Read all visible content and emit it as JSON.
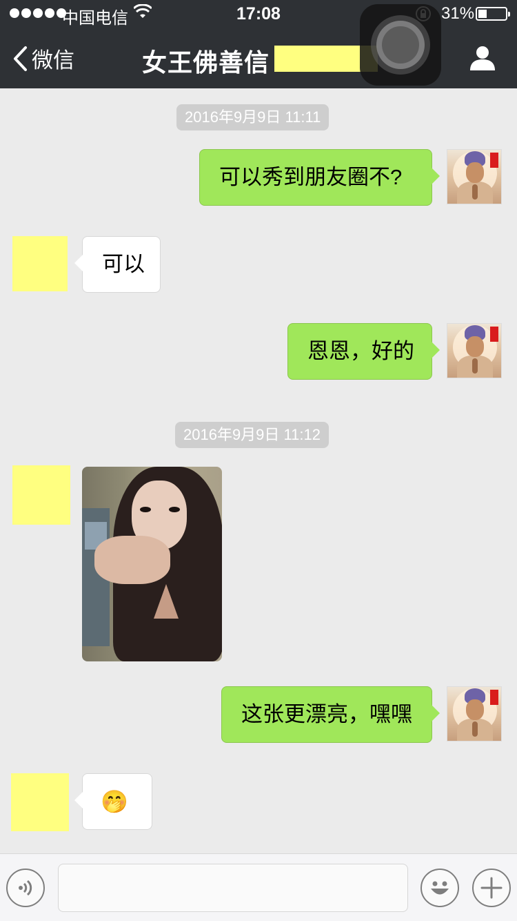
{
  "status_bar": {
    "carrier": "中国电信",
    "time": "17:08",
    "battery": "31%",
    "battery_level": 0.31
  },
  "nav": {
    "back_label": "微信",
    "title": "女王佛善信"
  },
  "messages": [
    {
      "kind": "timestamp",
      "text": "2016年9月9日 11:11"
    },
    {
      "kind": "sent",
      "text": "可以秀到朋友圈不?"
    },
    {
      "kind": "received",
      "text": "可以"
    },
    {
      "kind": "sent",
      "text": "恩恩，好的"
    },
    {
      "kind": "timestamp",
      "text": "2016年9月9日 11:12"
    },
    {
      "kind": "received-image",
      "text": ""
    },
    {
      "kind": "sent",
      "text": "这张更漂亮，嘿嘿"
    },
    {
      "kind": "received",
      "text": "🤭"
    }
  ],
  "toolbar": {
    "voice_icon": "voice-icon",
    "emoji_icon": "emoji-icon",
    "plus_icon": "plus-icon",
    "input_value": ""
  },
  "colors": {
    "sent_bubble": "#a0e75a",
    "received_bubble": "#ffffff",
    "background": "#ebebeb",
    "nav_bar": "#2e3135",
    "redaction": "#ffff80"
  }
}
